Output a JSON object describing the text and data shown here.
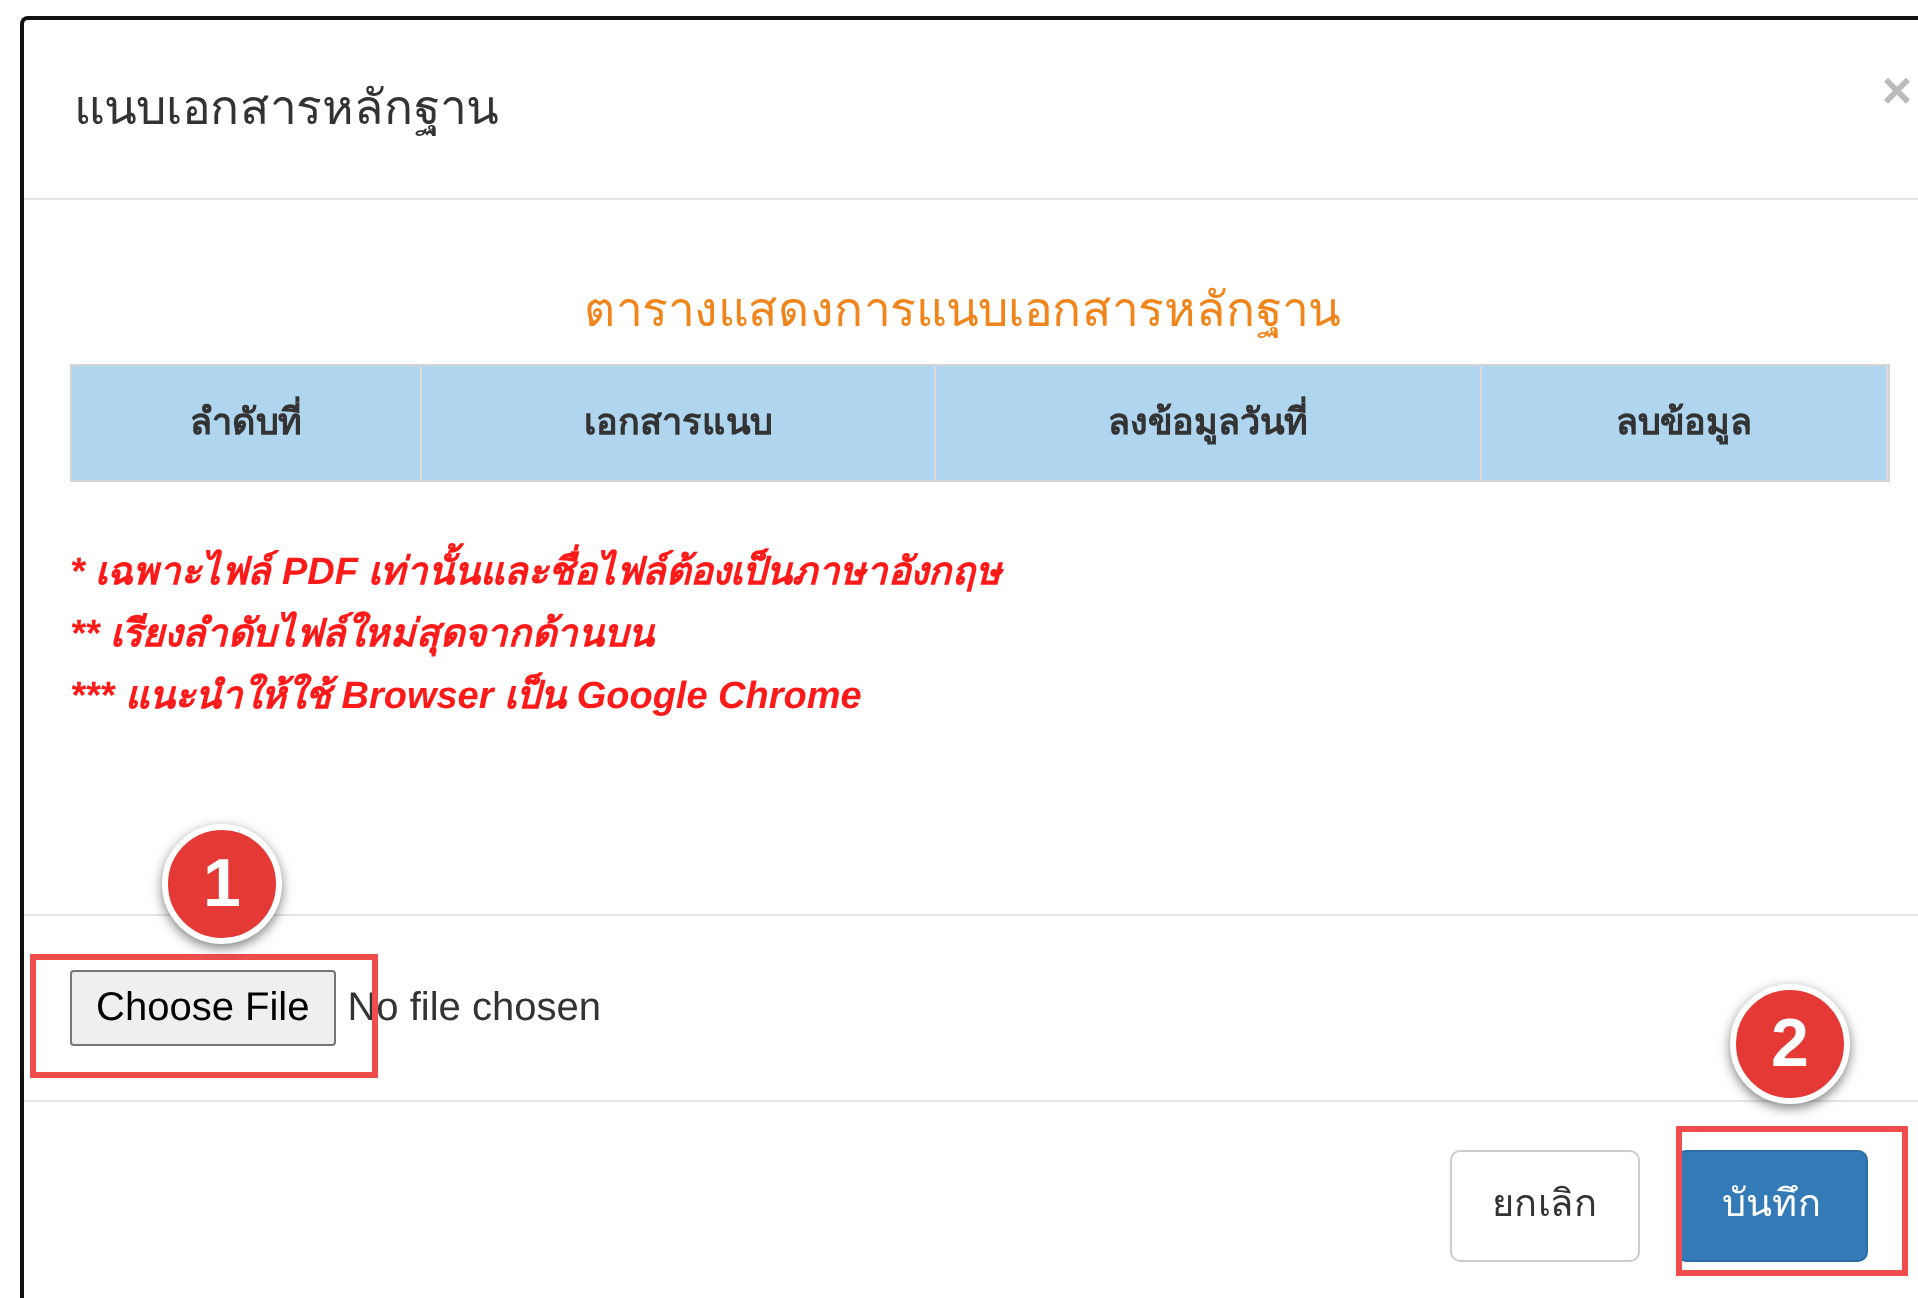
{
  "dialog": {
    "title": "แนบเอกสารหลักฐาน",
    "close": "×"
  },
  "table": {
    "title": "ตารางแสดงการแนบเอกสารหลักฐาน",
    "columns": [
      "ลำดับที่",
      "เอกสารแนบ",
      "ลงข้อมูลวันที่",
      "ลบข้อมูล"
    ]
  },
  "notes": [
    "* เฉพาะไฟล์ PDF เท่านั้นและชื่อไฟล์ต้องเป็นภาษาอังกฤษ",
    "** เรียงลำดับไฟล์ใหม่สุดจากด้านบน",
    "*** แนะนำให้ใช้ Browser เป็น Google Chrome"
  ],
  "file_input": {
    "button": "Choose File",
    "status": "No file chosen"
  },
  "footer": {
    "buttons": [
      {
        "label": "ยกเลิก",
        "kind": "default"
      },
      {
        "label": "บันทึก",
        "kind": "primary"
      }
    ]
  },
  "annotations": [
    {
      "label": "1"
    },
    {
      "label": "2"
    }
  ]
}
